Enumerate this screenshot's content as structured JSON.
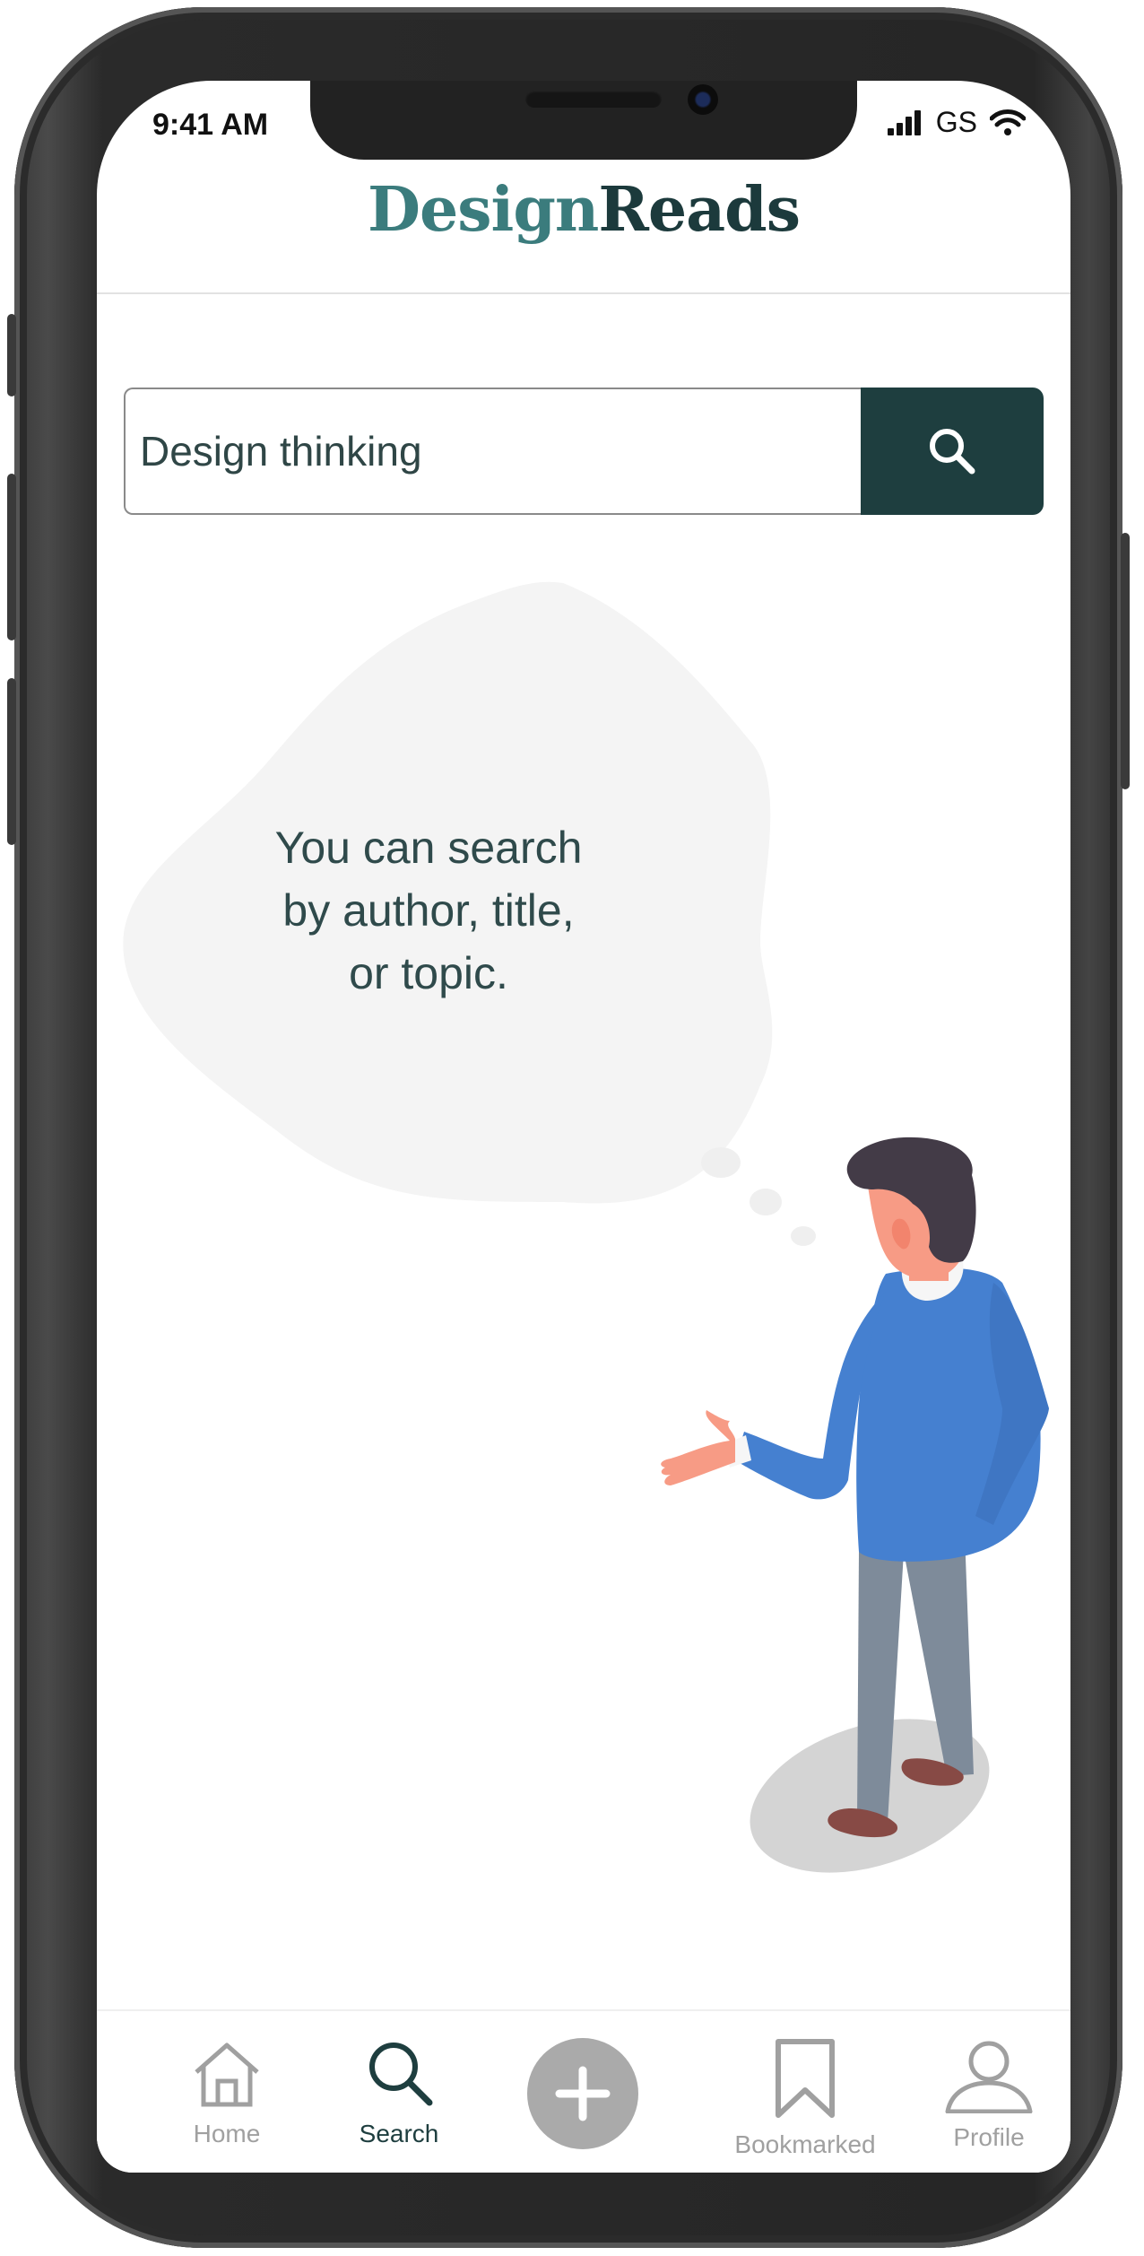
{
  "status_bar": {
    "time": "9:41 AM",
    "carrier": "GS"
  },
  "header": {
    "logo_part1": "Design",
    "logo_part2": "Reads"
  },
  "search": {
    "value": "Design thinking"
  },
  "hint": {
    "line1": "You can search",
    "line2": "by author, title,",
    "line3": "or topic."
  },
  "tabs": [
    {
      "label": "Home",
      "icon": "home-icon"
    },
    {
      "label": "Search",
      "icon": "search-icon",
      "active": true
    },
    {
      "label": "",
      "icon": "plus-icon"
    },
    {
      "label": "Bookmarked",
      "icon": "bookmark-icon"
    },
    {
      "label": "Profile",
      "icon": "profile-icon"
    }
  ],
  "colors": {
    "brand_dark": "#1e3e3f",
    "brand_teal": "#3b7c7d",
    "shirt_blue": "#4580d0",
    "inactive_gray": "#a0a0a0"
  }
}
